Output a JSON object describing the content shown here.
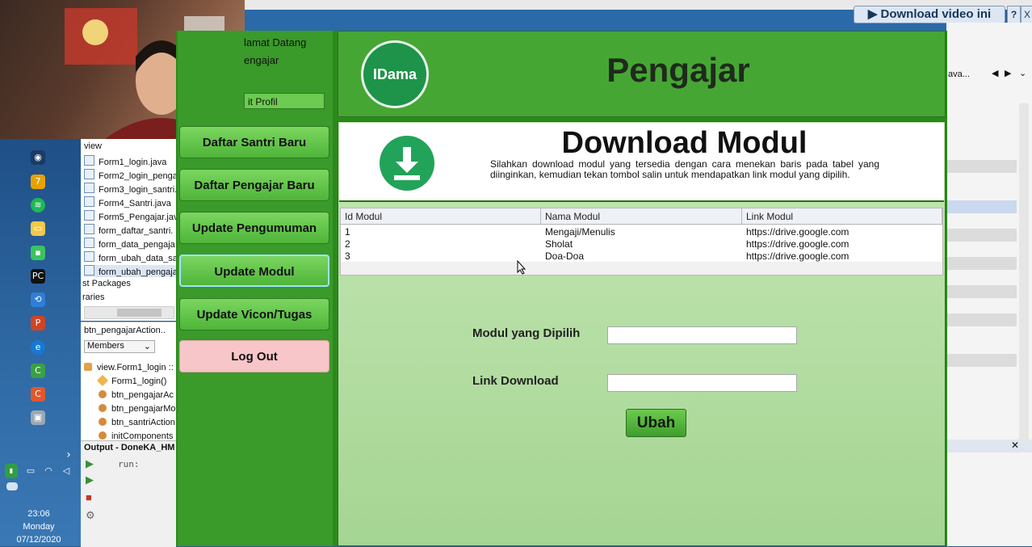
{
  "download_overlay": {
    "label": "▶ Download video ini",
    "help": "?",
    "close": "X"
  },
  "ide": {
    "project_tree": [
      "view",
      "Form1_login.java",
      "Form2_login_pengaj",
      "Form3_login_santri.",
      "Form4_Santri.java",
      "Form5_Pengajar.jav",
      "form_daftar_santri.",
      "form_data_pengaja",
      "form_ubah_data_sa",
      "form_ubah_pengaja",
      "st Packages",
      "raries"
    ],
    "navigator_title": "btn_pengajarAction..",
    "members_label": "Members",
    "members": [
      "view.Form1_login ::",
      "Form1_login()",
      "btn_pengajarAc",
      "btn_pengajarMo",
      "btn_santriAction",
      "initComponents"
    ],
    "output_title": "Output - DoneKA_HM",
    "output_text": "run:",
    "right_text": "ava..."
  },
  "taskbar": {
    "time": "23:06",
    "day": "Monday",
    "date": "07/12/2020"
  },
  "app": {
    "welcome_line1": "lamat Datang",
    "welcome_line2": "engajar",
    "edit_profile": "it Profil",
    "menu": [
      {
        "label": "Daftar Santri Baru"
      },
      {
        "label": "Daftar Pengajar Baru"
      },
      {
        "label": "Update Pengumuman"
      },
      {
        "label": "Update Modul"
      },
      {
        "label": "Update Vicon/Tugas"
      },
      {
        "label": "Log Out"
      }
    ],
    "header_title": "Pengajar",
    "logo_text": "IDama",
    "banner_title": "Download Modul",
    "banner_desc": "Silahkan download modul yang tersedia dengan cara menekan baris pada tabel yang diinginkan, kemudian tekan tombol salin untuk mendapatkan link modul yang dipilih.",
    "table": {
      "headers": [
        "Id Modul",
        "Nama Modul",
        "Link Modul"
      ],
      "rows": [
        [
          "1",
          "Mengaji/Menulis",
          "https://drive.google.com"
        ],
        [
          "2",
          "Sholat",
          "https://drive.google.com"
        ],
        [
          "3",
          "Doa-Doa",
          "https://drive.google.com"
        ]
      ]
    },
    "form": {
      "modul_label": "Modul yang Dipilih",
      "modul_value": "",
      "link_label": "Link Download",
      "link_value": ""
    },
    "ubah_button": "Ubah"
  },
  "colors": {
    "app_green": "#2c8a1c",
    "content_green": "#b5dea4",
    "logout_pink": "#f7c6c8"
  }
}
